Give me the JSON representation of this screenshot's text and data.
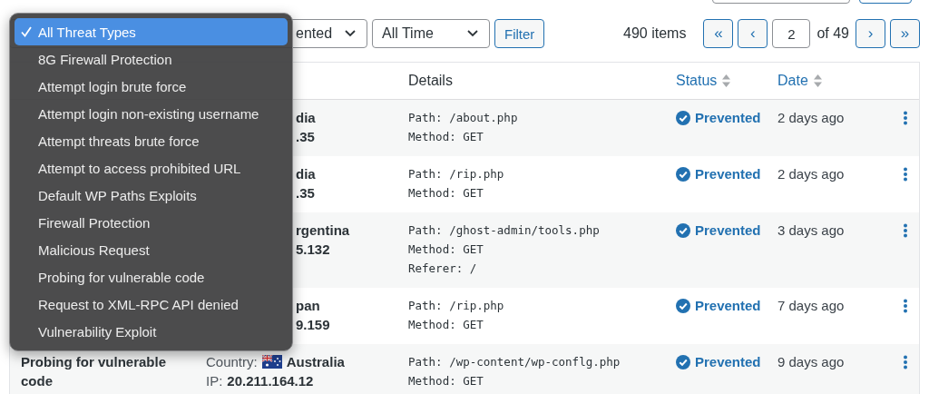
{
  "toolbar": {
    "status_select": {
      "value": "ented"
    },
    "time_select": {
      "value": "All Time"
    },
    "filter_button": "Filter",
    "items_count": "490 items",
    "pagination": {
      "first": "«",
      "previous": "‹",
      "page": "2",
      "of": "of 49",
      "next": "›",
      "last": "»"
    }
  },
  "table": {
    "columns": [
      {
        "label": "Details",
        "sortable": false
      },
      {
        "label": "Status",
        "sortable": true
      },
      {
        "label": "Date",
        "sortable": true
      }
    ],
    "rows": [
      {
        "location": [
          "dia",
          ".35"
        ],
        "details": [
          "Path: /about.php",
          "Method: GET"
        ],
        "status": "Prevented",
        "date": "2 days ago"
      },
      {
        "location": [
          "dia",
          ".35"
        ],
        "details": [
          "Path: /rip.php",
          "Method: GET"
        ],
        "status": "Prevented",
        "date": "2 days ago"
      },
      {
        "location": [
          "rgentina",
          "5.132"
        ],
        "details": [
          "Path: /ghost-admin/tools.php",
          "Method: GET",
          "Referer: /"
        ],
        "status": "Prevented",
        "date": "3 days ago"
      },
      {
        "location": [
          "pan",
          "9.159"
        ],
        "details": [
          "Path: /rip.php",
          "Method: GET"
        ],
        "status": "Prevented",
        "date": "7 days ago"
      },
      {
        "threat": "Probing for vulnerable code",
        "country_label": "Country:",
        "country": "Australia",
        "ip_label": "IP:",
        "ip": "20.211.164.12",
        "details": [
          "Path: /wp-content/wp-conflg.php",
          "Method: GET"
        ],
        "status": "Prevented",
        "date": "9 days ago"
      }
    ]
  },
  "threat_menu": {
    "items": [
      {
        "label": "All Threat Types",
        "selected": true
      },
      {
        "label": "8G Firewall Protection",
        "selected": false
      },
      {
        "label": "Attempt login brute force",
        "selected": false
      },
      {
        "label": "Attempt login non-existing username",
        "selected": false
      },
      {
        "label": "Attempt threats brute force",
        "selected": false
      },
      {
        "label": "Attempt to access prohibited URL",
        "selected": false
      },
      {
        "label": "Default WP Paths Exploits",
        "selected": false
      },
      {
        "label": "Firewall Protection",
        "selected": false
      },
      {
        "label": "Malicious Request",
        "selected": false
      },
      {
        "label": "Probing for vulnerable code",
        "selected": false
      },
      {
        "label": "Request to XML-RPC API denied",
        "selected": false
      },
      {
        "label": "Vulnerability Exploit",
        "selected": false
      }
    ]
  }
}
